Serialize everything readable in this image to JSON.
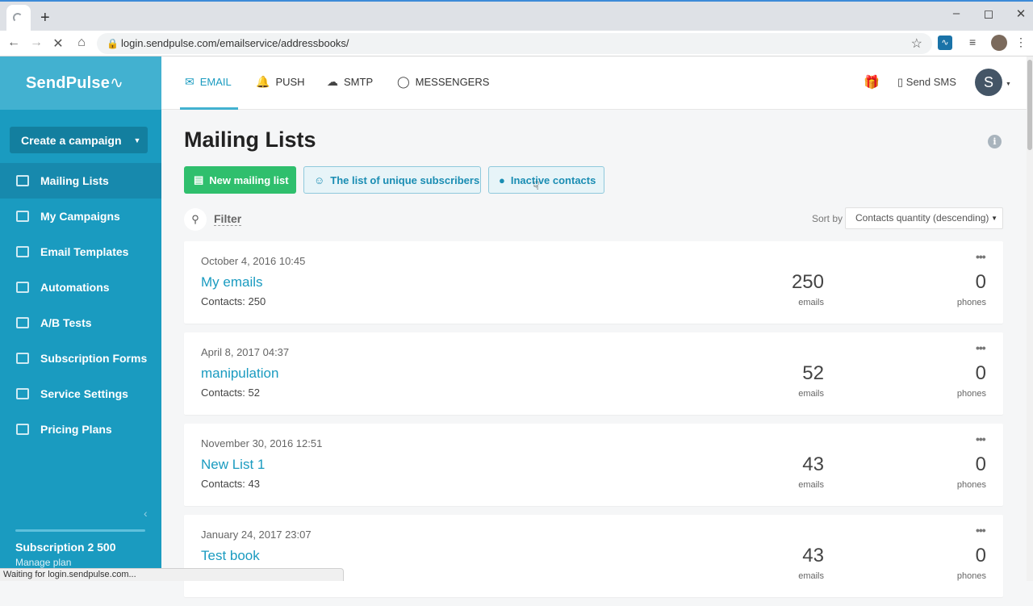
{
  "browser": {
    "url": "login.sendpulse.com/emailservice/addressbooks/",
    "status": "Waiting for login.sendpulse.com..."
  },
  "sidebar": {
    "logo": "SendPulse",
    "create_label": "Create a campaign",
    "items": [
      {
        "label": "Mailing Lists",
        "icon": "list-icon",
        "active": true
      },
      {
        "label": "My Campaigns",
        "icon": "campaign-icon",
        "active": false
      },
      {
        "label": "Email Templates",
        "icon": "template-icon",
        "active": false
      },
      {
        "label": "Automations",
        "icon": "automation-icon",
        "active": false
      },
      {
        "label": "A/B Tests",
        "icon": "ab-test-icon",
        "active": false
      },
      {
        "label": "Subscription Forms",
        "icon": "form-icon",
        "active": false
      },
      {
        "label": "Service Settings",
        "icon": "settings-icon",
        "active": false
      },
      {
        "label": "Pricing Plans",
        "icon": "pricing-icon",
        "active": false
      }
    ],
    "subscription_title": "Subscription 2 500",
    "subscription_link": "Manage plan"
  },
  "topnav": {
    "tabs": [
      {
        "label": "EMAIL",
        "icon": "envelope-icon",
        "active": true
      },
      {
        "label": "PUSH",
        "icon": "bell-icon",
        "active": false
      },
      {
        "label": "SMTP",
        "icon": "cloud-icon",
        "active": false
      },
      {
        "label": "MESSENGERS",
        "icon": "chat-icon",
        "active": false
      }
    ],
    "send_sms": "Send SMS",
    "avatar_initial": "S"
  },
  "main": {
    "title": "Mailing Lists",
    "new_list_label": "New mailing list",
    "unique_label": "The list of unique subscribers",
    "inactive_label": "Inactive contacts",
    "filter_label": "Filter",
    "sort_label": "Sort by",
    "sort_value": "Contacts quantity (descending)",
    "lists": [
      {
        "date": "October 4, 2016 10:45",
        "name": "My emails",
        "contacts": "Contacts: 250",
        "emails": "250",
        "emails_label": "emails",
        "phones": "0",
        "phones_label": "phones"
      },
      {
        "date": "April 8, 2017 04:37",
        "name": "manipulation",
        "contacts": "Contacts: 52",
        "emails": "52",
        "emails_label": "emails",
        "phones": "0",
        "phones_label": "phones"
      },
      {
        "date": "November 30, 2016 12:51",
        "name": "New List 1",
        "contacts": "Contacts: 43",
        "emails": "43",
        "emails_label": "emails",
        "phones": "0",
        "phones_label": "phones"
      },
      {
        "date": "January 24, 2017 23:07",
        "name": "Test book",
        "contacts": "",
        "emails": "43",
        "emails_label": "emails",
        "phones": "0",
        "phones_label": "phones"
      }
    ]
  },
  "colors": {
    "sidebar": "#1a9bc0",
    "primary_button": "#2fbf6d",
    "accent": "#1a9bc0"
  }
}
